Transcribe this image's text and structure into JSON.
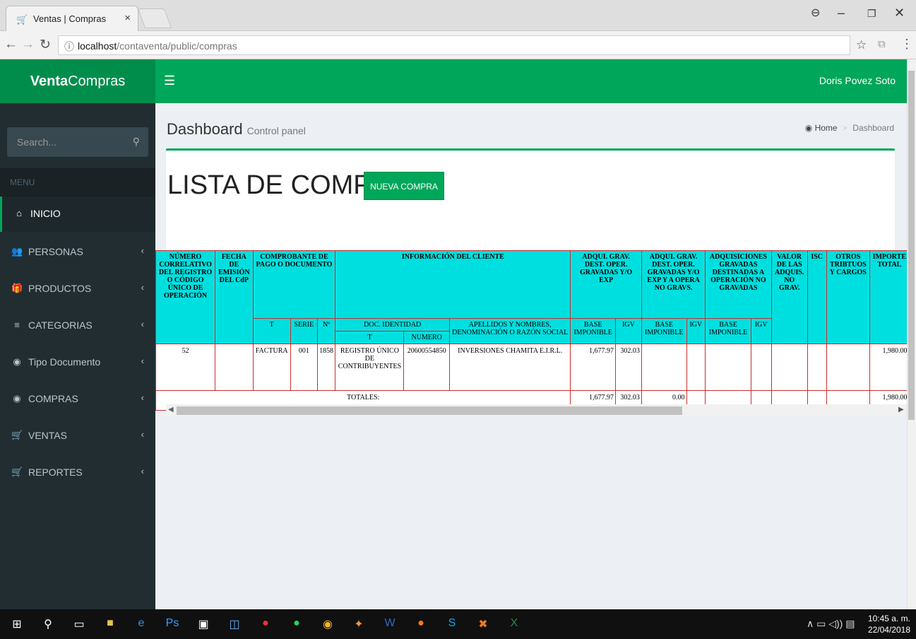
{
  "browser": {
    "tab_title": "Ventas | Compras",
    "tab_close": "×",
    "url_info": "ⓘ",
    "url_host": "localhost",
    "url_path": "/contaventa/public/compras"
  },
  "header": {
    "logo_bold": "Venta",
    "logo_rest": "Compras",
    "user_name": "Doris Povez Soto"
  },
  "sidebar": {
    "search_placeholder": "Search...",
    "menu_header": "MENU",
    "items": [
      {
        "label": "INICIO",
        "icon": "home-icon"
      },
      {
        "label": "PERSONAS",
        "icon": "users-icon"
      },
      {
        "label": "PRODUCTOS",
        "icon": "gift-icon"
      },
      {
        "label": "CATEGORIAS",
        "icon": "bars-icon"
      },
      {
        "label": "Tipo Documento",
        "icon": "dashboard-icon"
      },
      {
        "label": "COMPRAS",
        "icon": "dashboard-icon"
      },
      {
        "label": "VENTAS",
        "icon": "cart-icon"
      },
      {
        "label": "REPORTES",
        "icon": "cart-icon"
      }
    ]
  },
  "page": {
    "title": "Dashboard",
    "subtitle": "Control panel",
    "breadcrumb_home": "Home",
    "breadcrumb_current": "Dashboard",
    "list_title": "LISTA DE COMPRAS:",
    "new_button": "NUEVA COMPRA"
  },
  "table": {
    "h_num": "NÚMERO CORRELATIVO DEL REGISTRO O CÓDIGO ÚNICO DE OPERACIÓN",
    "h_fecha": "FECHA DE EMISIÓN DEL CdP",
    "h_comprobante": "COMPROBANTE DE PAGO O DOCUMENTO",
    "h_cliente": "INFORMACIÓN DEL CLIENTE",
    "h_adq1": "ADQUI. GRAV. DEST. OPER. GRAVADAS Y/O EXP",
    "h_adq2": "ADQUI. GRAV. DEST. OPER. GRAVADAS Y/O EXP Y A OPERA NO GRAVS.",
    "h_adq3": "ADQUISICIONES GRAVADAS DESTINADAS A OPERACIÓN NO GRAVADAS",
    "h_valor": "VALOR DE LAS ADQUIS. NO GRAV.",
    "h_isc": "ISC",
    "h_otros": "OTROS TRIBTUOS Y CARGOS",
    "h_total": "IMPORTE TOTAL",
    "h_t": "T",
    "h_serie": "SERIE",
    "h_nro": "Nº",
    "h_doc": "DOC. IDENTIDAD",
    "h_apellidos": "APELLIDOS Y NOMBRES, DENOMINACIÓN O RAZÓN SOCIAL",
    "h_base": "BASE IMPONIBLE",
    "h_igv": "IGV",
    "h_doc_t": "T",
    "h_doc_num": "NUMERO",
    "row": {
      "num": "52",
      "fecha": "",
      "tipo": "FACTURA",
      "serie": "001",
      "nro": "1858",
      "doc_t": "REGISTRO ÚNICO DE CONTRIBUYENTES",
      "doc_num": "20600554850",
      "razon": "INVERSIONES CHAMITA E.I.R.L.",
      "base1": "1,677.97",
      "igv1": "302.03",
      "total": "1,980.00"
    },
    "totals": {
      "label": "TOTALES:",
      "base1": "1,677.97",
      "igv1": "302.03",
      "base2": "0.00",
      "total": "1,980.00"
    }
  },
  "taskbar": {
    "time": "10:45 a. m.",
    "date": "22/04/2018"
  }
}
